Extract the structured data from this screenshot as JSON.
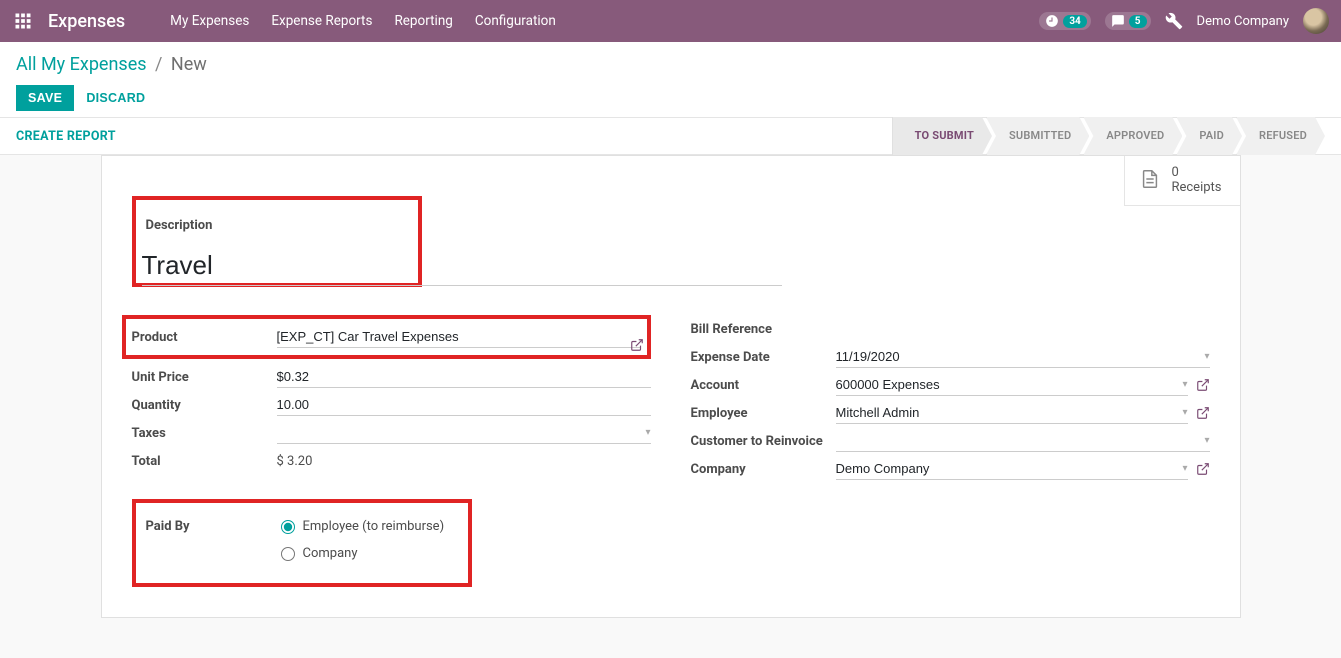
{
  "nav": {
    "brand": "Expenses",
    "menu": [
      "My Expenses",
      "Expense Reports",
      "Reporting",
      "Configuration"
    ],
    "clock_badge": "34",
    "msg_badge": "5",
    "company": "Demo Company"
  },
  "breadcrumb": {
    "root": "All My Expenses",
    "current": "New"
  },
  "buttons": {
    "save": "SAVE",
    "discard": "DISCARD",
    "create_report": "CREATE REPORT"
  },
  "status": {
    "steps": [
      "TO SUBMIT",
      "SUBMITTED",
      "APPROVED",
      "PAID",
      "REFUSED"
    ],
    "active": 0
  },
  "receipts": {
    "count": "0",
    "label": "Receipts"
  },
  "form": {
    "description_label": "Description",
    "description_value": "Travel",
    "left": {
      "product_label": "Product",
      "product_value": "[EXP_CT] Car Travel Expenses",
      "unit_price_label": "Unit Price",
      "unit_price_value": "$0.32",
      "quantity_label": "Quantity",
      "quantity_value": "10.00",
      "taxes_label": "Taxes",
      "taxes_value": "",
      "total_label": "Total",
      "total_value": "$ 3.20",
      "paid_by_label": "Paid By",
      "paid_by_opts": [
        "Employee (to reimburse)",
        "Company"
      ],
      "paid_by_selected": 0
    },
    "right": {
      "bill_ref_label": "Bill Reference",
      "bill_ref_value": "",
      "expense_date_label": "Expense Date",
      "expense_date_value": "11/19/2020",
      "account_label": "Account",
      "account_value": "600000 Expenses",
      "employee_label": "Employee",
      "employee_value": "Mitchell Admin",
      "customer_label": "Customer to Reinvoice",
      "customer_value": "",
      "company_label": "Company",
      "company_value": "Demo Company"
    }
  }
}
